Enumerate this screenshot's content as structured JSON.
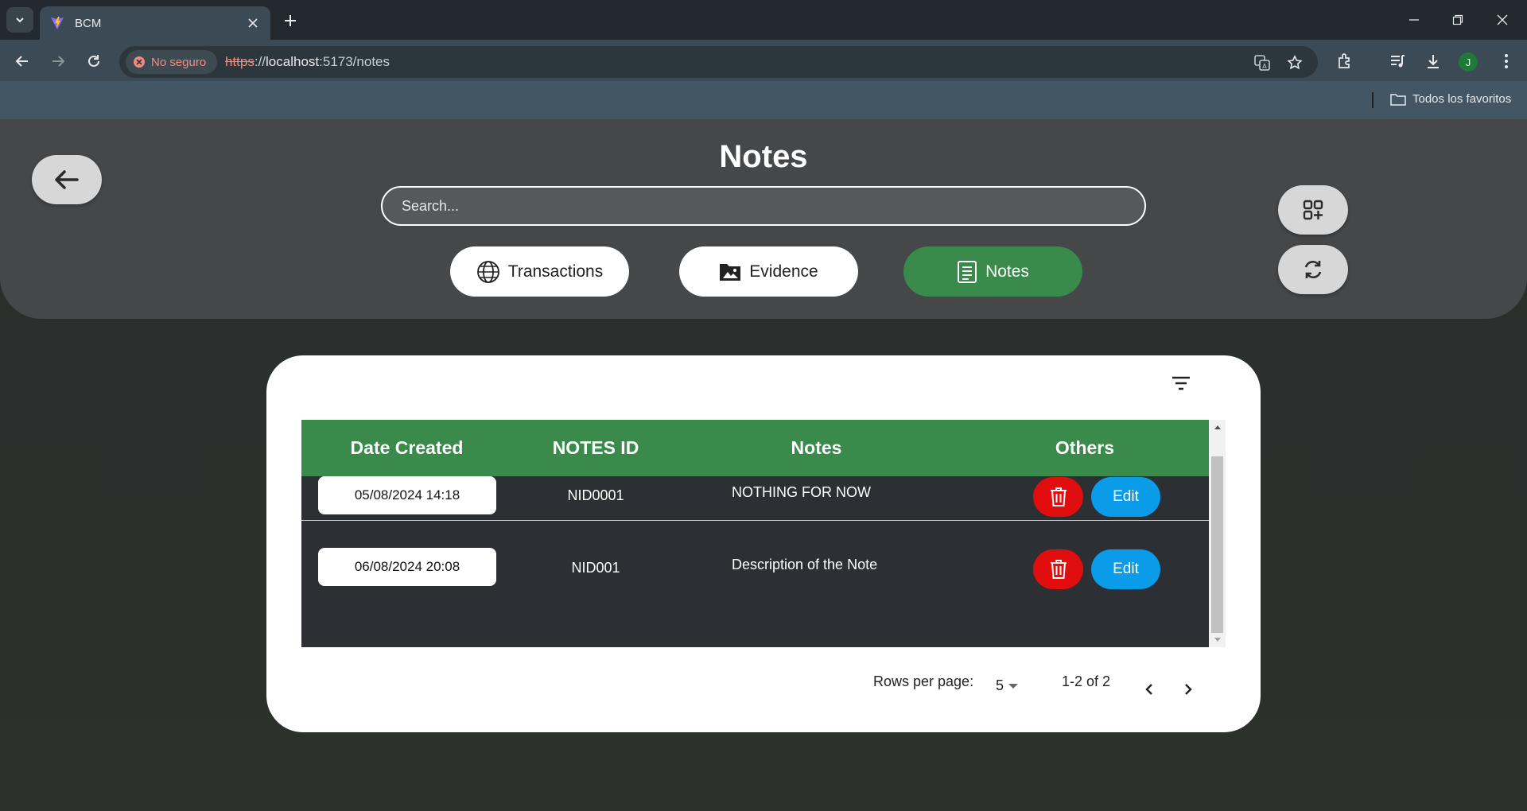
{
  "browser": {
    "tab_title": "BCM",
    "security_label": "No seguro",
    "url_scheme": "https",
    "url_sep": "://",
    "url_host": "localhost",
    "url_rest": ":5173/notes",
    "profile_initial": "J",
    "bookmarks_label": "Todos los favoritos"
  },
  "header": {
    "title": "Notes",
    "search_placeholder": "Search...",
    "nav": [
      {
        "label": "Transactions",
        "icon": "globe-icon",
        "active": false
      },
      {
        "label": "Evidence",
        "icon": "image-folder-icon",
        "active": false
      },
      {
        "label": "Notes",
        "icon": "document-icon",
        "active": true
      }
    ],
    "colors": {
      "active_nav": "#3a8a4b",
      "header_bg": "#454749"
    }
  },
  "table": {
    "columns": [
      "Date Created",
      "NOTES ID",
      "Notes",
      "Others"
    ],
    "rows": [
      {
        "date": "05/08/2024 14:18",
        "id": "NID0001",
        "note": "NOTHING FOR NOW",
        "edit": "Edit"
      },
      {
        "date": "06/08/2024 20:08",
        "id": "NID001",
        "note": "Description of the Note",
        "edit": "Edit"
      }
    ],
    "colors": {
      "header": "#3a8a4b",
      "delete": "#e00e0e",
      "edit": "#0a9be9"
    }
  },
  "pagination": {
    "rows_per_page_label": "Rows per page:",
    "rows_per_page": "5",
    "range": "1-2 of 2"
  }
}
